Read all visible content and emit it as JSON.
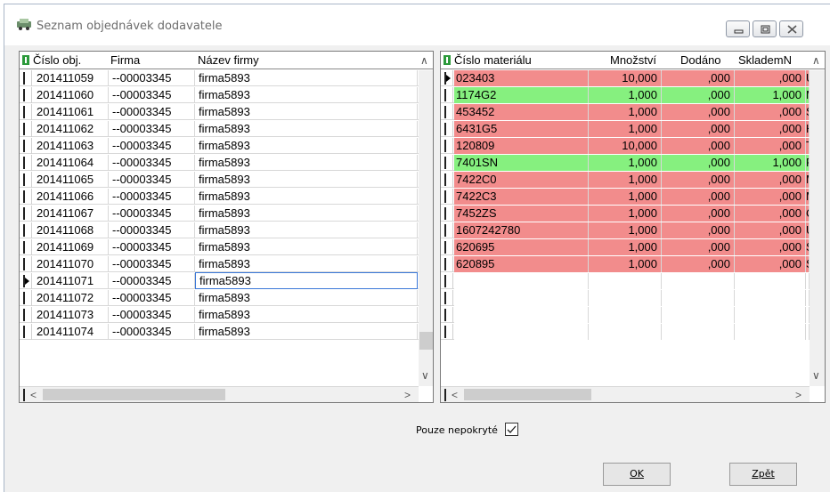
{
  "window": {
    "title": "Seznam objednávek dodavatele"
  },
  "orders": {
    "columns": [
      "Číslo obj.",
      "Firma",
      "Název firmy"
    ],
    "rows": [
      [
        "201411059",
        "--00003345",
        "firma5893"
      ],
      [
        "201411060",
        "--00003345",
        "firma5893"
      ],
      [
        "201411061",
        "--00003345",
        "firma5893"
      ],
      [
        "201411062",
        "--00003345",
        "firma5893"
      ],
      [
        "201411063",
        "--00003345",
        "firma5893"
      ],
      [
        "201411064",
        "--00003345",
        "firma5893"
      ],
      [
        "201411065",
        "--00003345",
        "firma5893"
      ],
      [
        "201411066",
        "--00003345",
        "firma5893"
      ],
      [
        "201411067",
        "--00003345",
        "firma5893"
      ],
      [
        "201411068",
        "--00003345",
        "firma5893"
      ],
      [
        "201411069",
        "--00003345",
        "firma5893"
      ],
      [
        "201411070",
        "--00003345",
        "firma5893"
      ],
      [
        "201411071",
        "--00003345",
        "firma5893"
      ],
      [
        "201411072",
        "--00003345",
        "firma5893"
      ],
      [
        "201411073",
        "--00003345",
        "firma5893"
      ],
      [
        "201411074",
        "--00003345",
        "firma5893"
      ]
    ],
    "selected_row": 12
  },
  "materials": {
    "columns": [
      "Číslo materiálu",
      "Množství",
      "Dodáno",
      "SklademN"
    ],
    "rows": [
      {
        "cells": [
          "023403",
          "10,000",
          ",000",
          ",000",
          "U"
        ],
        "status": "red"
      },
      {
        "cells": [
          "1174G2",
          "1,000",
          ",000",
          "1,000",
          "M"
        ],
        "status": "green"
      },
      {
        "cells": [
          "453452",
          "1,000",
          ",000",
          ",000",
          "S"
        ],
        "status": "red"
      },
      {
        "cells": [
          "6431G5",
          "1,000",
          ",000",
          ",000",
          "H"
        ],
        "status": "red"
      },
      {
        "cells": [
          "120809",
          "10,000",
          ",000",
          ",000",
          "T"
        ],
        "status": "red"
      },
      {
        "cells": [
          "7401SN",
          "1,000",
          ",000",
          "1,000",
          "F"
        ],
        "status": "green"
      },
      {
        "cells": [
          "7422C0",
          "1,000",
          ",000",
          ",000",
          "M"
        ],
        "status": "red"
      },
      {
        "cells": [
          "7422C3",
          "1,000",
          ",000",
          ",000",
          "M"
        ],
        "status": "red"
      },
      {
        "cells": [
          "7452ZS",
          "1,000",
          ",000",
          ",000",
          "C"
        ],
        "status": "red"
      },
      {
        "cells": [
          "1607242780",
          "1,000",
          ",000",
          ",000",
          "U"
        ],
        "status": "red"
      },
      {
        "cells": [
          "620695",
          "1,000",
          ",000",
          ",000",
          "S"
        ],
        "status": "red"
      },
      {
        "cells": [
          "620895",
          "1,000",
          ",000",
          ",000",
          "S"
        ],
        "status": "red"
      }
    ],
    "empty_rows": 4,
    "selected_row": 0
  },
  "checkbox": {
    "label": "Pouze nepokryté",
    "checked": true
  },
  "buttons": {
    "ok_label": "OK",
    "back_label": "Zpět"
  },
  "colors": {
    "row_red": "#f28c8c",
    "row_green": "#86f07f",
    "selected_border": "#3b78d8"
  }
}
